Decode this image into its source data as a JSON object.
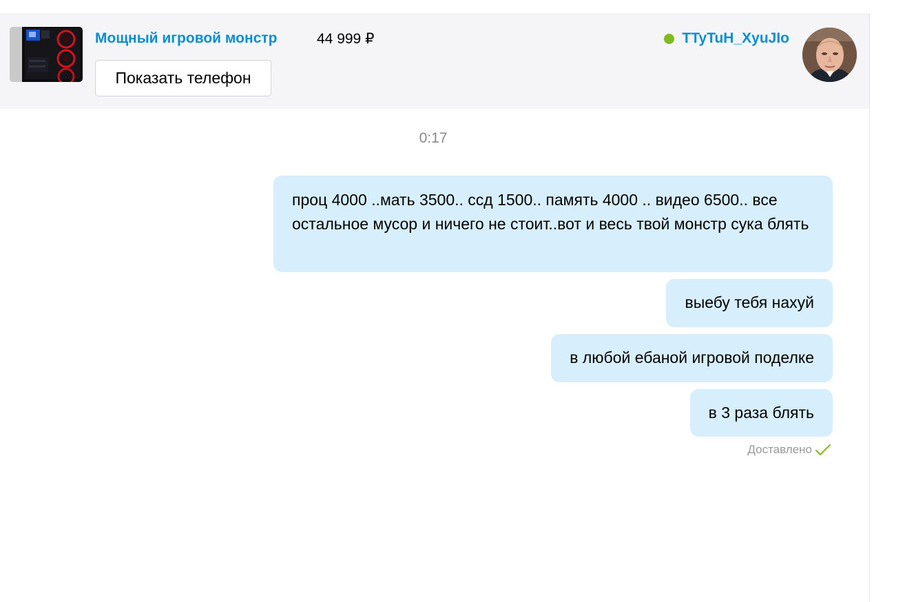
{
  "listing": {
    "title": "Мощный игровой монстр",
    "price": "44 999 ₽",
    "thumbnail_icon": "pc-case-thumbnail"
  },
  "phone_button": {
    "label": "Показать телефон"
  },
  "user": {
    "name": "TTyTuH_XyuJIo",
    "status_color": "#7fbb20",
    "avatar_icon": "user-avatar"
  },
  "chat": {
    "timestamp": "0:17",
    "messages": [
      {
        "text": "проц 4000 ..мать 3500.. ссд 1500.. память 4000 .. видео 6500.. все остальное мусор  и ничего не стоит..вот и весь твой монстр сука блять"
      },
      {
        "text": "выебу тебя нахуй"
      },
      {
        "text": "в любой ебаной  игровой поделке"
      },
      {
        "text": "в 3 раза блять"
      }
    ],
    "delivery_status": "Доставлено",
    "delivery_icon": "check-icon"
  },
  "colors": {
    "link": "#0a8ed0",
    "bubble": "#d7effc",
    "header_background": "#f5f5f7",
    "check": "#7fbb20"
  }
}
